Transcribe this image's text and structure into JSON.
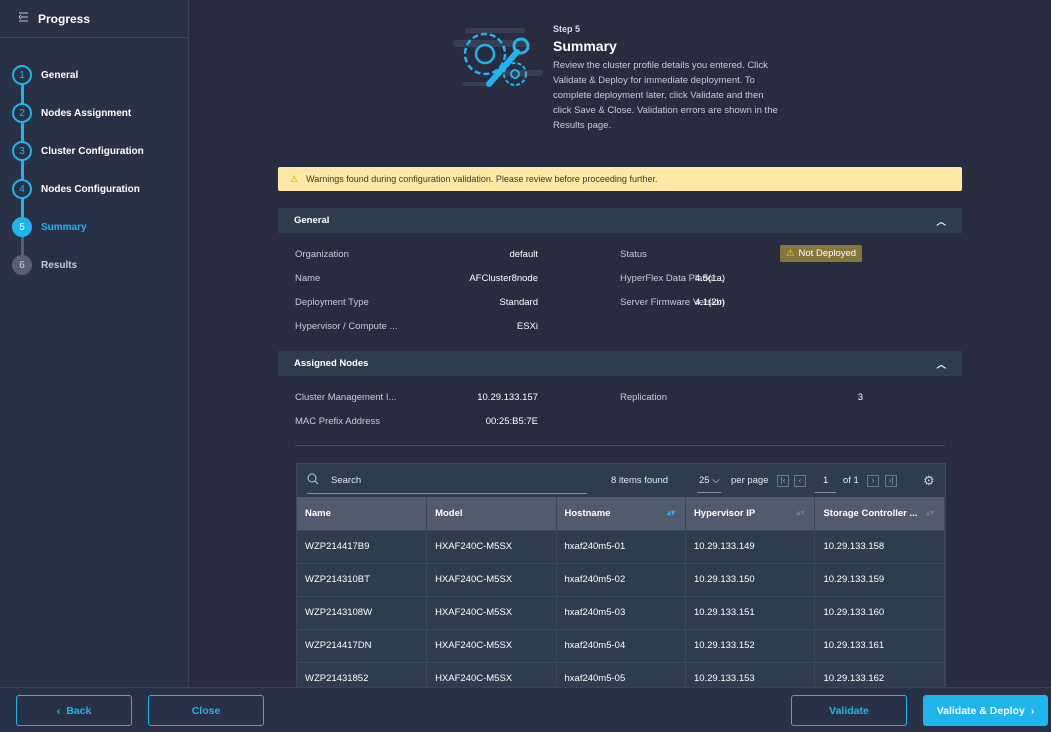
{
  "sidebar": {
    "title": "Progress",
    "steps": [
      {
        "num": "1",
        "label": "General",
        "state": "done"
      },
      {
        "num": "2",
        "label": "Nodes Assignment",
        "state": "done"
      },
      {
        "num": "3",
        "label": "Cluster Configuration",
        "state": "done"
      },
      {
        "num": "4",
        "label": "Nodes Configuration",
        "state": "done"
      },
      {
        "num": "5",
        "label": "Summary",
        "state": "active"
      },
      {
        "num": "6",
        "label": "Results",
        "state": "todo"
      }
    ]
  },
  "hero": {
    "step": "Step 5",
    "title": "Summary",
    "description": "Review the cluster profile details you entered. Click Validate & Deploy for immediate deployment. To complete deployment later, click Validate and then click Save & Close. Validation errors are shown in the Results page."
  },
  "warning": "Warnings found during configuration validation. Please review before proceeding further.",
  "general": {
    "title": "General",
    "left": [
      [
        "Organization",
        "default"
      ],
      [
        "Name",
        "AFCluster8node"
      ],
      [
        "Deployment Type",
        "Standard"
      ],
      [
        "Hypervisor / Compute ...",
        "ESXi"
      ]
    ],
    "status_label": "Status",
    "status_value": "Not Deployed",
    "right": [
      [
        "HyperFlex Data Platfor...",
        "4.5(1a)"
      ],
      [
        "Server Firmware Version",
        "4.1(2b)"
      ]
    ]
  },
  "assigned": {
    "title": "Assigned Nodes",
    "items": [
      [
        "Cluster Management I...",
        "10.29.133.157"
      ],
      [
        "MAC Prefix Address",
        "00:25:B5:7E"
      ]
    ],
    "replication_label": "Replication",
    "replication_value": "3"
  },
  "table": {
    "search_placeholder": "Search",
    "items_found": "8 items found",
    "per_page_value": "25",
    "per_page_label": "per page",
    "page": "1",
    "of": "of 1",
    "columns": [
      "Name",
      "Model",
      "Hostname",
      "Hypervisor IP",
      "Storage Controller ..."
    ],
    "rows": [
      [
        "WZP214417B9",
        "HXAF240C-M5SX",
        "hxaf240m5-01",
        "10.29.133.149",
        "10.29.133.158"
      ],
      [
        "WZP214310BT",
        "HXAF240C-M5SX",
        "hxaf240m5-02",
        "10.29.133.150",
        "10.29.133.159"
      ],
      [
        "WZP2143108W",
        "HXAF240C-M5SX",
        "hxaf240m5-03",
        "10.29.133.151",
        "10.29.133.160"
      ],
      [
        "WZP214417DN",
        "HXAF240C-M5SX",
        "hxaf240m5-04",
        "10.29.133.152",
        "10.29.133.161"
      ],
      [
        "WZP21431852",
        "HXAF240C-M5SX",
        "hxaf240m5-05",
        "10.29.133.153",
        "10.29.133.162"
      ]
    ]
  },
  "footer": {
    "back": "Back",
    "close": "Close",
    "validate": "Validate",
    "deploy": "Validate & Deploy"
  },
  "colors": {
    "accent": "#1fb4ec",
    "warning_bg": "#fde9a5",
    "badge": "#84773c"
  }
}
